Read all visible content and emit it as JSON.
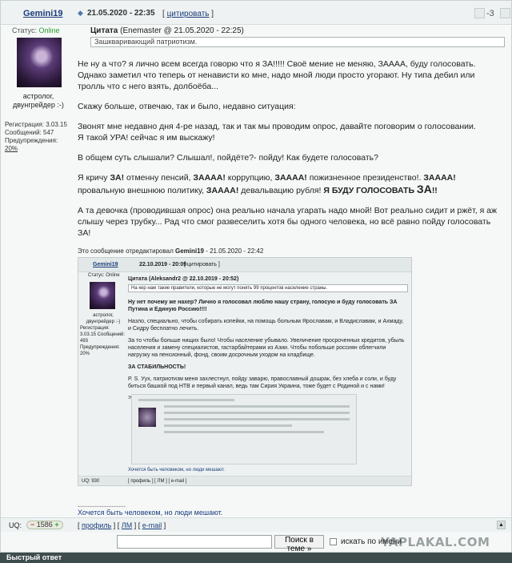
{
  "post": {
    "username": "Gemini19",
    "date": "21.05.2020 - 22:35",
    "quote_link": "цитировать",
    "karma": "-3"
  },
  "user": {
    "status_label": "Статус:",
    "status_value": "Online",
    "title": "астролог, двунгрейдер :-)",
    "reg": "Регистрация: 3.03.15",
    "msgs": "Сообщений: 547",
    "warn": "Предупреждения:",
    "warn_value": "20%"
  },
  "quote": {
    "label": "Цитата",
    "author": "(Enemaster @ 21.05.2020 - 22:25)",
    "text": "Зашкваривающий патриотизм."
  },
  "body": {
    "p1": "Не ну а что? я лично всем всегда говорю что я ЗА!!!!! Своё мение не меняю, ЗАААА, буду голосовать.",
    "p1b": "Однако заметил что теперь от ненависти ко мне, надо мной люди просто угорают. Ну типа дебил или тролль что с него взять, долбоёба...",
    "p2": "Скажу больше, отвечаю, так и было, недавно ситуация:",
    "p3": "Звонят мне недавно дня 4-ре назад, так и так мы проводим опрос, давайте поговорим о голосовании.",
    "p3b": "Я такой УРА! сейчас я им выскажу!",
    "p4": "В общем суть слышали? Слышал!, пойдёте?- пойду! Как будете голосовать?",
    "p5a": "Я кричу ",
    "p5_za": "ЗА!",
    "p5b": " отменну пенсий, ",
    "p5_zaaa": "ЗАААА!",
    "p5c": " коррупцию, ",
    "p5_zaaaa": "ЗАААА!",
    "p5d": " пожизненное президенство!. ",
    "p5_zaaa2": "ЗАААА!",
    "p5e": " провальную внешнюю политику, ",
    "p5_zaaa3": "ЗАААА!",
    "p5f": " девальвацию рубля! ",
    "p5_vote": "Я БУДУ ГОЛОСОВАТЬ",
    "p5_big": "ЗА",
    "p5_end": "!!",
    "p6": "А та девочка (проводившая опрос) она реально начала угарать надо мной! Вот реально сидит и ржёт, я аж слышу через трубку... Рад что смог развеселить хотя бы одного человека, но всё равно пойду голосовать ЗА!",
    "edited_prefix": "Это сообщение отредактировал ",
    "edited_user": "Gemini19",
    "edited_suffix": " - 21.05.2020 - 22:42"
  },
  "embed": {
    "username": "Gemini19",
    "date": "22.10.2019 - 20:09",
    "quote_link": "[ цитировать ]",
    "status": "Статус: Online",
    "title": "астролог, двунгрейдер :-)",
    "meta": "Регистрация: 3.03.15 Сообщений: 493 Предупреждения: 20%",
    "quote_label": "Цитата (Aleksandr2 @ 22.10.2019 - 20:52)",
    "quote_text": "На кер нам такие правители, которые не могут понять 99 процентов население страны.",
    "p1": "Ну нет почему же нахер? Лично я голосовал люблю нашу страну, голосую и буду голосовать ЗА Путина и Единую Россию!!!!",
    "p2": "Назло, специально, чтобы собирать копейки, на помощь больным Ярославам, и Владиславам, и Ахмаду, и Сидру бесплатно лечить.",
    "p3": "За то чтобы больше нищих было! Чтобы население убывало. Увеличение просроченных кредитов, убыль населения и замену специалистов, гастарбайтерами из Азии. Чтобы побольше россиян облегчили нагрузку на пенсионный, фонд, своим досрочным уходом на кладбище.",
    "p4": "ЗА СТАБИЛЬНОСТЬ!",
    "p5": "P. S. Уух, патриотизм меня захлестнул, пойду заварю, православный дошрак, без хлеба и соли, и буду биться башкой под НТВ и первый канал, ведь там Сирия Украина, тоже будет с Родиной и с нами!",
    "edited": "Это сообщение отредактировал Gemini19 - 22.10.2019 - 22:13",
    "sig": "Хочется быть человеком, но люди мешают.",
    "uq": "UQ: 930",
    "links": "[ профиль ] [ ЛМ ] [ e-mail ]"
  },
  "footer": {
    "sig_sep": "--------------------",
    "signature": "Хочется быть человеком, но люди мешают.",
    "uq_label": "UQ:",
    "uq_value": "1586",
    "link_profile": "профиль",
    "link_pm": "ЛМ",
    "link_email": "e-mail"
  },
  "search": {
    "button": "Поиск в теме »",
    "checkbox_label": "искать по имени"
  },
  "watermark": "YAPLAKAL.COM",
  "quick_reply": "Быстрый ответ",
  "colors": {
    "accent": "#1a3d7c",
    "online": "#2e9e2e",
    "quick_bar": "#3e4c4c"
  }
}
